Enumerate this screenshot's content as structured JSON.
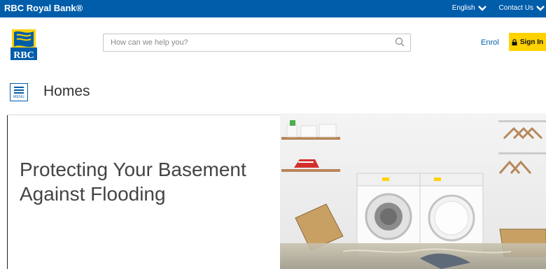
{
  "topbar": {
    "brand": "RBC Royal Bank®",
    "language": "English",
    "contact": "Contact Us"
  },
  "header": {
    "logo_text": "RBC",
    "search_placeholder": "How can we help you?",
    "enrol_label": "Enrol",
    "signin_label": "Sign In"
  },
  "nav": {
    "menu_label": "MENU",
    "section_title": "Homes"
  },
  "hero": {
    "title": "Protecting Your Basement Against Flooding"
  },
  "colors": {
    "brand_blue": "#005daa",
    "signin_yellow": "#ffd200"
  }
}
